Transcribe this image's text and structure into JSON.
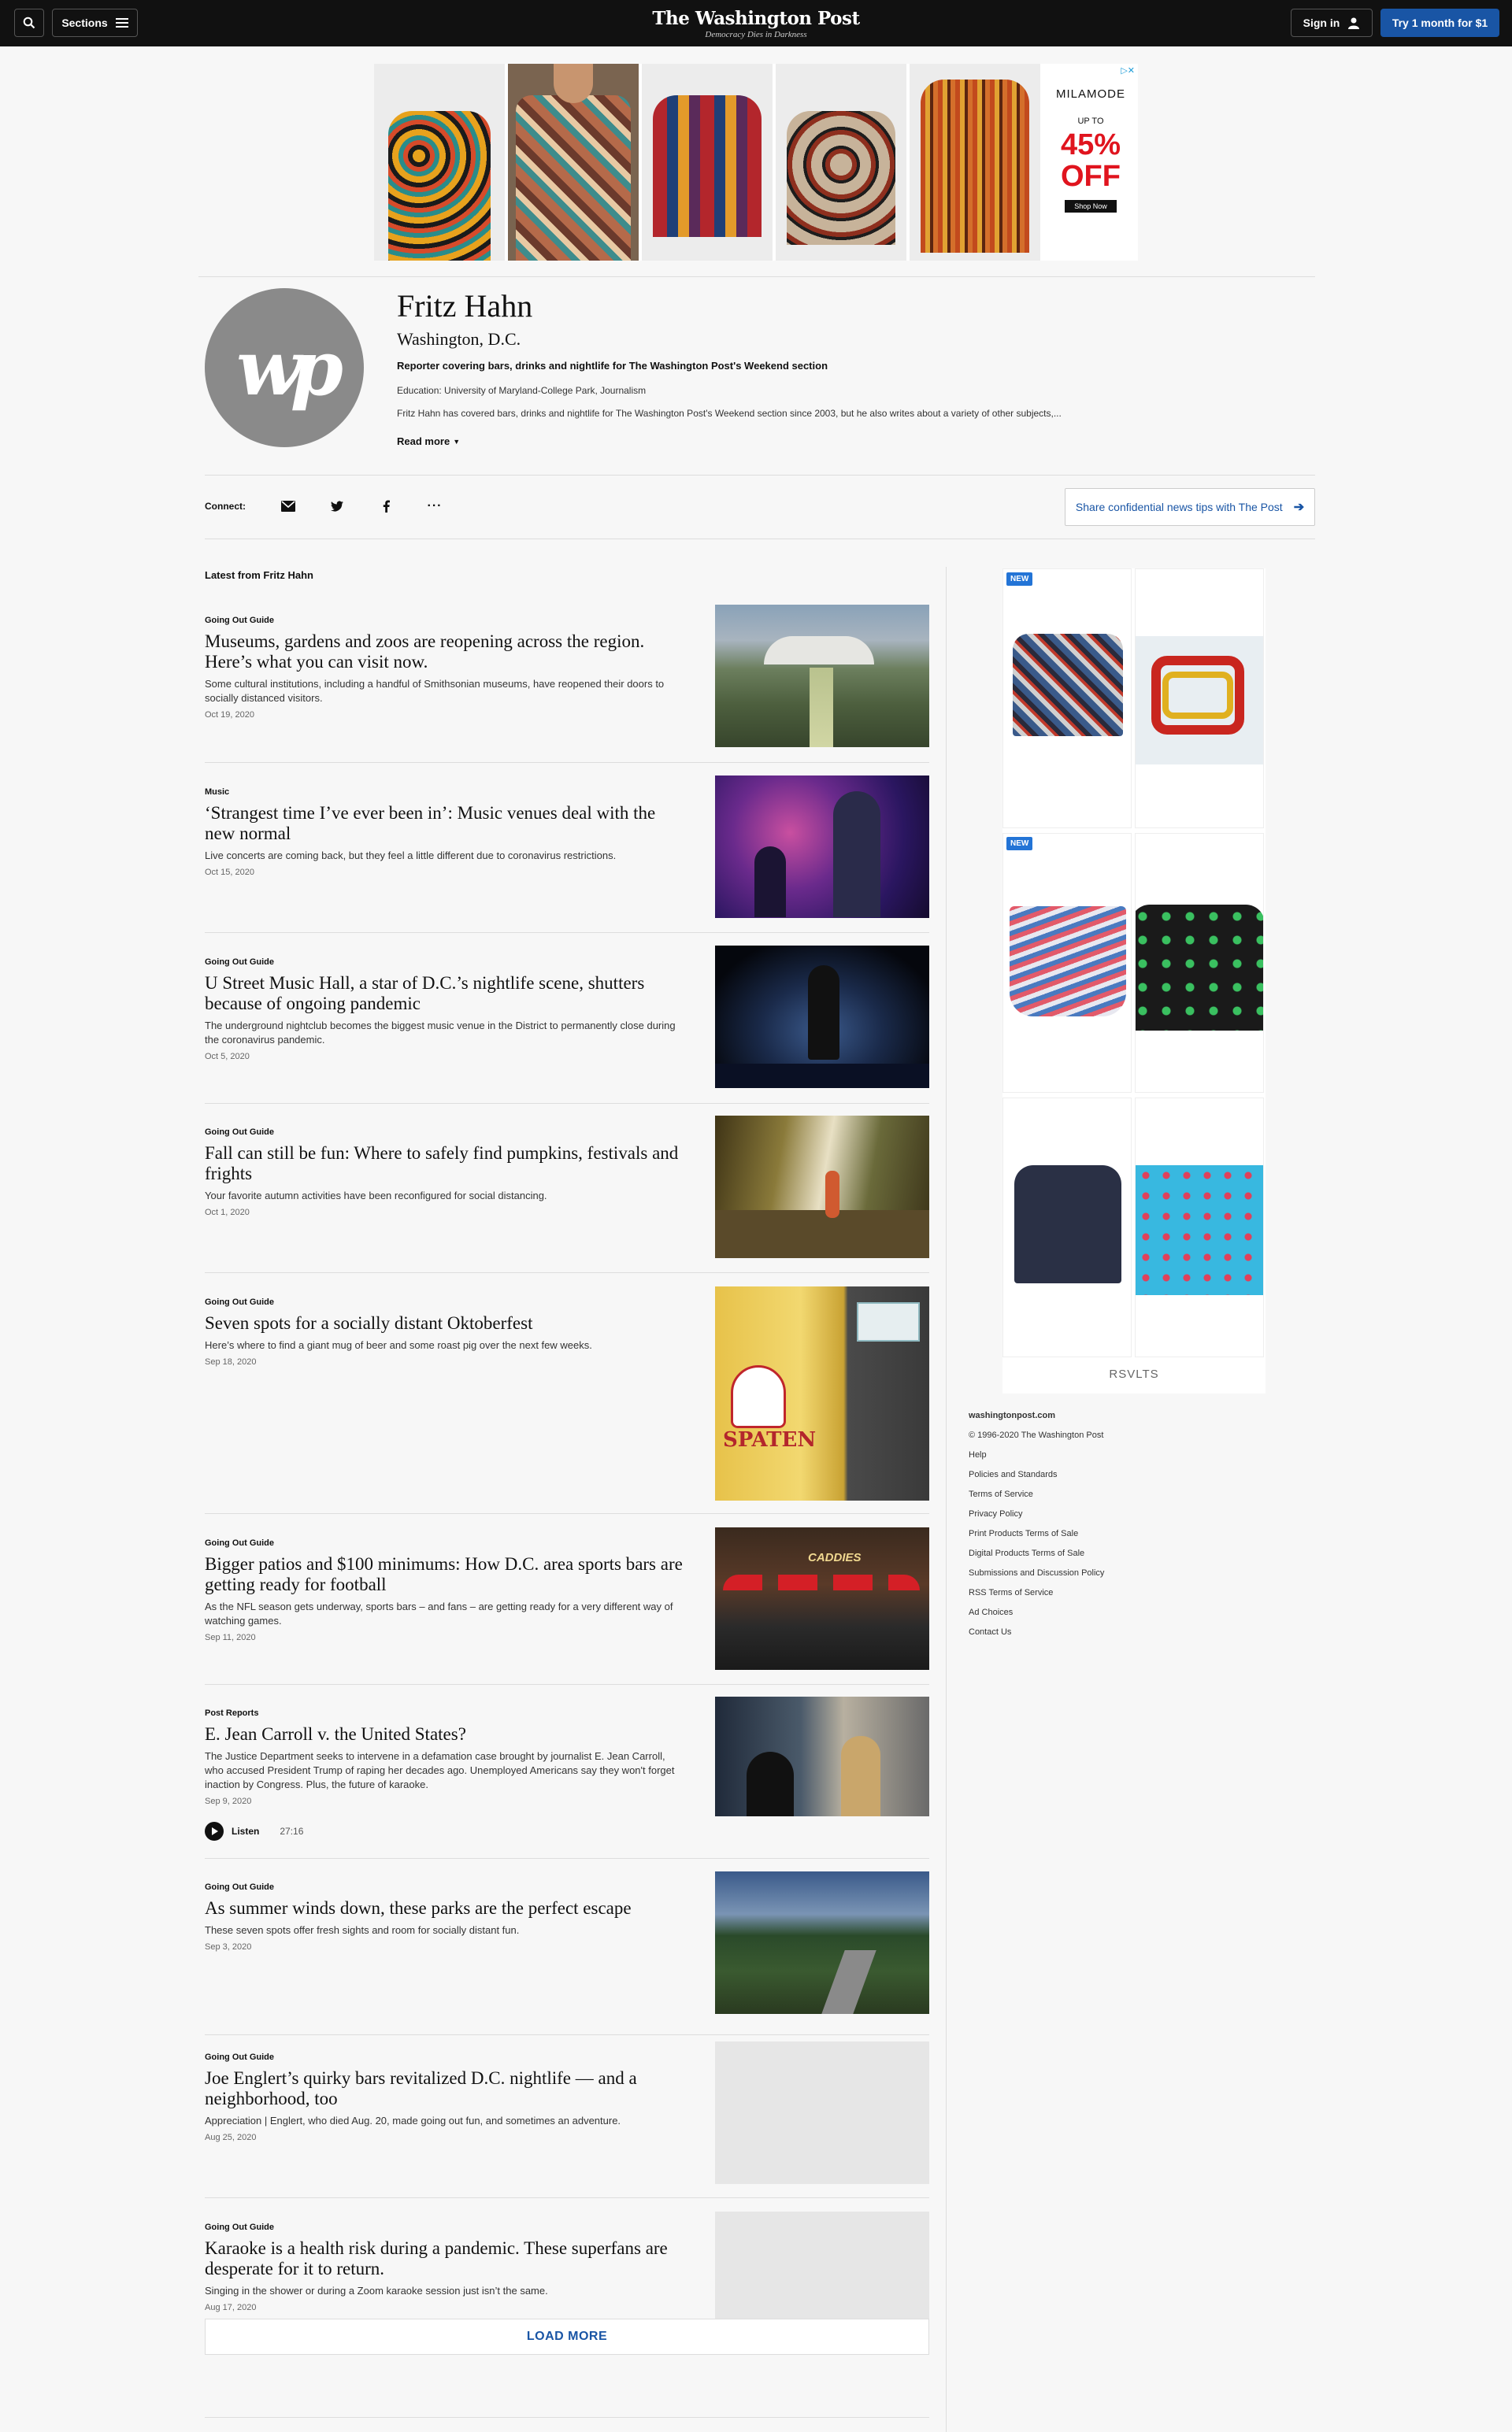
{
  "nav": {
    "sections_label": "Sections",
    "logo_title": "The Washington Post",
    "logo_tagline": "Democracy Dies in Darkness",
    "signin_label": "Sign in",
    "try_label": "Try 1 month for $1"
  },
  "top_ad": {
    "brand": "MILAMODE",
    "upto": "UP TO",
    "percent": "45%",
    "off": "OFF",
    "cta": "Shop Now"
  },
  "profile": {
    "name": "Fritz Hahn",
    "location": "Washington, D.C.",
    "role": "Reporter covering bars, drinks and nightlife for The Washington Post's Weekend section",
    "education": "Education: University of Maryland-College Park, Journalism",
    "bio": "Fritz Hahn has covered bars, drinks and nightlife for The Washington Post's Weekend section since 2003, but he also writes about a variety of other subjects,...",
    "read_more": "Read more",
    "avatar_text": "wp"
  },
  "connect": {
    "label": "Connect:",
    "share_label": "Share confidential news tips with The Post"
  },
  "latest_heading": "Latest from Fritz Hahn",
  "articles": [
    {
      "kicker": "Going Out Guide",
      "headline": "Museums, gardens and zoos are reopening across the region. Here’s what you can visit now.",
      "blurb": "Some cultural institutions, including a handful of Smithsonian museums, have reopened their doors to socially distanced visitors.",
      "date": "Oct 19, 2020"
    },
    {
      "kicker": "Music",
      "headline": "‘Strangest time I’ve ever been in’: Music venues deal with the new normal",
      "blurb": "Live concerts are coming back, but they feel a little different due to coronavirus restrictions.",
      "date": "Oct 15, 2020"
    },
    {
      "kicker": "Going Out Guide",
      "headline": "U Street Music Hall, a star of D.C.’s nightlife scene, shutters because of ongoing pandemic",
      "blurb": "The underground nightclub becomes the biggest music venue in the District to permanently close during the coronavirus pandemic.",
      "date": "Oct 5, 2020"
    },
    {
      "kicker": "Going Out Guide",
      "headline": "Fall can still be fun: Where to safely find pumpkins, festivals and frights",
      "blurb": "Your favorite autumn activities have been reconfigured for social distancing.",
      "date": "Oct 1, 2020"
    },
    {
      "kicker": "Going Out Guide",
      "headline": "Seven spots for a socially distant Oktoberfest",
      "blurb": "Here’s where to find a giant mug of beer and some roast pig over the next few weeks.",
      "date": "Sep 18, 2020",
      "image_text": "SPATEN"
    },
    {
      "kicker": "Going Out Guide",
      "headline": "Bigger patios and $100 minimums: How D.C. area sports bars are getting ready for football",
      "blurb": "As the NFL season gets underway, sports bars – and fans – are getting ready for a very different way of watching games.",
      "date": "Sep 11, 2020",
      "image_text": "CADDIES"
    },
    {
      "kicker": "Post Reports",
      "headline": "E. Jean Carroll v. the United States?",
      "blurb": "The Justice Department seeks to intervene in a defamation case brought by journalist E. Jean Carroll, who accused President Trump of raping her decades ago. Unemployed Americans say they won't forget inaction by Congress. Plus, the future of karaoke.",
      "date": "Sep 9, 2020",
      "listen_label": "Listen",
      "duration": "27:16"
    },
    {
      "kicker": "Going Out Guide",
      "headline": "As summer winds down, these parks are the perfect escape",
      "blurb": "These seven spots offer fresh sights and room for socially distant fun.",
      "date": "Sep 3, 2020"
    },
    {
      "kicker": "Going Out Guide",
      "headline": "Joe Englert’s quirky bars revitalized D.C. nightlife — and a neighborhood, too",
      "blurb": "Appreciation | Englert, who died Aug. 20, made going out fun, and sometimes an adventure.",
      "date": "Aug 25, 2020"
    },
    {
      "kicker": "Going Out Guide",
      "headline": "Karaoke is a health risk during a pandemic. These superfans are desperate for it to return.",
      "blurb": "Singing in the shower or during a Zoom karaoke session just isn’t the same.",
      "date": "Aug 17, 2020"
    }
  ],
  "load_more": "LOAD MORE",
  "rail_ad": {
    "new_badge": "NEW",
    "brand": "RSVLTS"
  },
  "footer": {
    "site": "washingtonpost.com",
    "links": [
      "© 1996-2020 The Washington Post",
      "Help",
      "Policies and Standards",
      "Terms of Service",
      "Privacy Policy",
      "Print Products Terms of Sale",
      "Digital Products Terms of Sale",
      "Submissions and Discussion Policy",
      "RSS Terms of Service",
      "Ad Choices",
      "Contact Us"
    ]
  },
  "colors": {
    "accent": "#1955a5",
    "topbar": "#111111",
    "ad_red": "#e0141e"
  },
  "icons": [
    "search-icon",
    "menu-icon",
    "user-icon",
    "email-icon",
    "twitter-icon",
    "facebook-icon",
    "more-icon",
    "arrow-right-icon",
    "caret-down-icon",
    "play-icon",
    "adchoices-icon"
  ]
}
